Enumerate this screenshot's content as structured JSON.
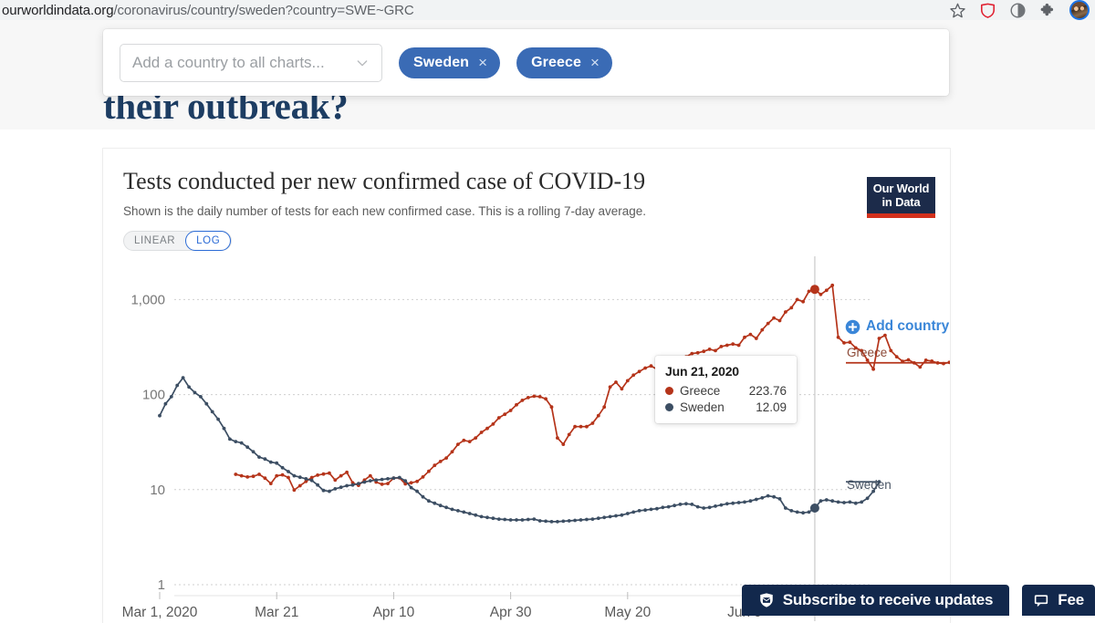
{
  "browser": {
    "url_host": "ourworldindata.org",
    "url_path": "/coronavirus/country/sweden?country=SWE~GRC",
    "icons": [
      "bookmark-star-icon",
      "shield-icon",
      "brave-rewards-icon",
      "extensions-puzzle-icon",
      "profile-avatar"
    ]
  },
  "page": {
    "headline_fragment": "their outbreak?"
  },
  "country_panel": {
    "select_placeholder": "Add a country to all charts...",
    "chevron": "chevron-down-icon",
    "pills": [
      {
        "label": "Sweden",
        "remove": "×"
      },
      {
        "label": "Greece",
        "remove": "×"
      }
    ]
  },
  "chart": {
    "title": "Tests conducted per new confirmed case of COVID-19",
    "subtitle": "Shown is the daily number of tests for each new confirmed case. This is a rolling 7-day average.",
    "logo_line1": "Our World",
    "logo_line2": "in Data",
    "scale_options": [
      {
        "label": "LINEAR",
        "active": false
      },
      {
        "label": "LOG",
        "active": true
      }
    ],
    "add_country_label": "Add country",
    "add_country_icon": "plus-circle-icon",
    "series_end_labels": [
      {
        "name": "Greece",
        "color": "#b5341a"
      },
      {
        "name": "Sweden",
        "color": "#3c4e63"
      }
    ]
  },
  "tooltip": {
    "date": "Jun 21, 2020",
    "rows": [
      {
        "name": "Greece",
        "value": "223.76",
        "color": "#b5341a"
      },
      {
        "name": "Sweden",
        "value": "12.09",
        "color": "#3c4e63"
      }
    ]
  },
  "sticky": {
    "subscribe_label": "Subscribe to receive updates",
    "subscribe_icon": "envelope-badge-icon",
    "feedback_label": "Fee",
    "feedback_icon": "speech-bubble-icon"
  },
  "chart_data": {
    "type": "line",
    "title": "Tests conducted per new confirmed case of COVID-19",
    "subtitle": "Shown is the daily number of tests for each new confirmed case. This is a rolling 7-day average.",
    "xlabel": "",
    "ylabel": "",
    "yscale": "log",
    "ylim": [
      1,
      2000
    ],
    "ytick_labels": [
      "1,000",
      "100",
      "10",
      "1"
    ],
    "ytick_values": [
      1000,
      100,
      10,
      1
    ],
    "xtick_labels": [
      "Mar 1, 2020",
      "Mar 21",
      "Apr 10",
      "Apr 30",
      "May 20",
      "Jun 9"
    ],
    "xtick_dates": [
      "2020-03-01",
      "2020-03-21",
      "2020-04-10",
      "2020-04-30",
      "2020-05-20",
      "2020-06-09"
    ],
    "x_start": "2020-03-01",
    "x_end": "2020-06-26",
    "grid": "horizontal-dashed",
    "legend": "series-end-labels",
    "highlight_date": "2020-06-21",
    "series": [
      {
        "name": "Greece",
        "color": "#b5341a",
        "start_day": 13,
        "values": [
          14.5,
          14.0,
          13.6,
          13.8,
          14.5,
          13.2,
          11.6,
          14.0,
          14.3,
          13.4,
          9.9,
          11.0,
          12.2,
          13.4,
          14.2,
          14.6,
          14.9,
          12.6,
          14.0,
          15.2,
          11.8,
          11.1,
          12.6,
          14.0,
          12.0,
          11.4,
          11.6,
          13.2,
          13.3,
          11.5,
          11.8,
          12.2,
          13.6,
          15.6,
          18.0,
          19.8,
          21.5,
          25.0,
          30.0,
          33.0,
          32.0,
          35.0,
          40.0,
          44.0,
          49.0,
          57.0,
          62.0,
          68.0,
          78.0,
          87.0,
          93.0,
          96.0,
          95.0,
          90.0,
          74.0,
          35.0,
          30.0,
          38.0,
          46.0,
          46.0,
          46.0,
          50.0,
          60.0,
          74.0,
          120.0,
          135.0,
          115.0,
          140.0,
          160.0,
          175.0,
          190.0,
          200.0,
          185.0,
          195.0,
          175.0,
          190.0,
          230.0,
          250.0,
          270.0,
          275.0,
          285.0,
          300.0,
          290.0,
          320.0,
          330.0,
          340.0,
          330.0,
          400.0,
          430.0,
          390.0,
          480.0,
          560.0,
          640.0,
          600.0,
          740.0,
          820.0,
          1000.0,
          950.0,
          1220.0,
          1280.0,
          1130.0,
          1250.0,
          1410.0,
          400.0,
          350.0,
          355.0,
          310.0,
          290.0,
          230.0,
          185.0,
          390.0,
          420.0,
          290.0,
          250.0,
          223.76,
          232.0,
          215.0,
          195.0,
          230.0,
          225.0,
          215.0,
          212.0,
          218.0,
          216.0
        ]
      },
      {
        "name": "Sweden",
        "color": "#3c4e63",
        "start_day": 0,
        "values": [
          60.0,
          80.0,
          95.0,
          125.0,
          150.0,
          120.0,
          105.0,
          95.0,
          80.0,
          66.0,
          55.0,
          44.0,
          34.0,
          32.0,
          31.0,
          28.0,
          25.0,
          22.0,
          21.0,
          19.5,
          19.0,
          17.0,
          15.5,
          14.0,
          13.5,
          13.0,
          12.5,
          11.2,
          9.8,
          9.6,
          10.2,
          10.6,
          11.0,
          11.2,
          11.6,
          12.0,
          12.4,
          12.6,
          12.8,
          13.0,
          13.2,
          13.4,
          12.4,
          10.5,
          9.6,
          8.4,
          7.6,
          7.2,
          6.8,
          6.5,
          6.2,
          6.0,
          5.8,
          5.6,
          5.4,
          5.2,
          5.1,
          5.0,
          4.9,
          4.85,
          4.8,
          4.8,
          4.8,
          4.85,
          4.9,
          4.7,
          4.65,
          4.6,
          4.6,
          4.65,
          4.7,
          4.75,
          4.8,
          4.85,
          4.9,
          5.0,
          5.1,
          5.2,
          5.3,
          5.4,
          5.6,
          5.8,
          6.0,
          6.1,
          6.2,
          6.3,
          6.5,
          6.6,
          6.8,
          7.0,
          7.1,
          7.0,
          6.6,
          6.4,
          6.5,
          6.7,
          6.9,
          7.1,
          7.2,
          7.3,
          7.4,
          7.6,
          7.9,
          8.2,
          8.6,
          8.4,
          8.0,
          6.4,
          6.0,
          5.8,
          5.7,
          5.8,
          6.4,
          7.6,
          7.8,
          7.6,
          7.4,
          7.3,
          7.4,
          7.2,
          7.4,
          8.1,
          9.6,
          12.09
        ]
      }
    ]
  }
}
